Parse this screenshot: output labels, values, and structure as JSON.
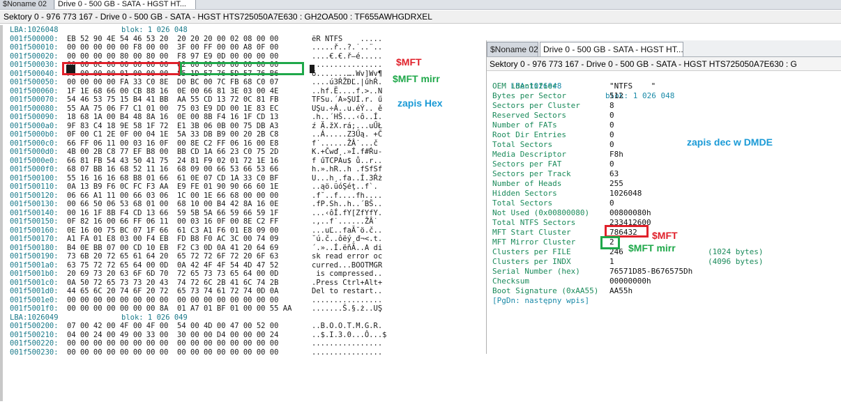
{
  "tabs": [
    {
      "label": "$Noname 02"
    },
    {
      "label": "Drive 0 - 500 GB - SATA - HGST HT..."
    }
  ],
  "status_text": "Sektory 0 - 976 773 167 - Drive 0 - 500 GB - SATA - HGST HTS725050A7E630 : GH2OA500 : TF655AWHGDRXEL",
  "hex_view": {
    "lba1": {
      "lba": "LBA:1026048",
      "blok": "blok: 1 026 048"
    },
    "rows1": [
      {
        "addr": "001f500000:",
        "hex": "EB 52 90 4E 54 46 53 20  20 20 20 00 02 08 00 00",
        "ascii": "ëR NTFS    ....."
      },
      {
        "addr": "001f500010:",
        "hex": "00 00 00 00 00 F8 00 00  3F 00 FF 00 00 A8 0F 00",
        "ascii": ".....ř..?.˙..¨.."
      },
      {
        "addr": "001f500020:",
        "hex": "00 00 00 00 80 00 80 00  F8 97 E9 0D 00 00 00 00",
        "ascii": "....€.€.ř—é....."
      },
      {
        "addr": "001f500030:",
        "hex": "00 00 0C 00 00 00 00 00  02 00 00 00 00 00 00 00",
        "ascii": "................"
      },
      {
        "addr": "001f500040:",
        "hex": "F6 00 00 00 01 00 00 00  85 1D 57 76 5D 57 76 B6",
        "ascii": "ö.......….Wv]Wv¶"
      },
      {
        "addr": "001f500050:",
        "hex": "00 00 00 00 FA 33 C0 8E  D0 BC 00 7C FB 68 C0 07",
        "ascii": "....ú3ŔŽĐĽ.|űhŔ."
      },
      {
        "addr": "001f500060:",
        "hex": "1F 1E 68 66 00 CB 88 16  0E 00 66 81 3E 03 00 4E",
        "ascii": "..hf.Ë....f.>..N"
      },
      {
        "addr": "001f500070:",
        "hex": "54 46 53 75 15 B4 41 BB  AA 55 CD 13 72 0C 81 FB",
        "ascii": "TFSu.´A»ŞUÍ.r. ű"
      },
      {
        "addr": "001f500080:",
        "hex": "55 AA 75 06 F7 C1 01 00  75 03 E9 DD 00 1E 83 EC",
        "ascii": "UŞu.÷Á..u.éÝ.. ě"
      },
      {
        "addr": "001f500090:",
        "hex": "18 68 1A 00 B4 48 8A 16  0E 00 8B F4 16 1F CD 13",
        "ascii": ".h..´HŠ...‹ô..Í."
      },
      {
        "addr": "001f5000a0:",
        "hex": "9F 83 C4 18 9E 58 1F 72  E1 3B 06 0B 00 75 DB A3",
        "ascii": "ź Ä.žX.rá;...uŰŁ"
      },
      {
        "addr": "001f5000b0:",
        "hex": "0F 00 C1 2E 0F 00 04 1E  5A 33 DB B9 00 20 2B C8",
        "ascii": "..Á.....Z3Űą. +Č"
      },
      {
        "addr": "001f5000c0:",
        "hex": "66 FF 06 11 00 03 16 0F  00 8E C2 FF 06 16 00 E8",
        "ascii": "f˙......ŽÂ˙...č"
      },
      {
        "addr": "001f5000d0:",
        "hex": "4B 00 2B C8 77 EF B8 00  BB CD 1A 66 23 C0 75 2D",
        "ascii": "K.+Čwď¸.»Í.f#Ŕu-"
      },
      {
        "addr": "001f5000e0:",
        "hex": "66 81 FB 54 43 50 41 75  24 81 F9 02 01 72 1E 16",
        "ascii": "f űTCPAu$ ů..r.."
      },
      {
        "addr": "001f5000f0:",
        "hex": "68 07 BB 16 68 52 11 16  68 09 00 66 53 66 53 66",
        "ascii": "h.».hR..h .fSfSf"
      },
      {
        "addr": "001f500100:",
        "hex": "55 16 16 16 68 B8 01 66  61 0E 07 CD 1A 33 C0 BF",
        "ascii": "U...h¸.fa..Í.3Ŕż"
      },
      {
        "addr": "001f500110:",
        "hex": "0A 13 B9 F6 0C FC F3 AA  E9 FE 01 90 90 66 60 1E",
        "ascii": "..ąö.üóŞéţ..f`."
      },
      {
        "addr": "001f500120:",
        "hex": "06 66 A1 11 00 66 03 06  1C 00 1E 66 68 00 00 00",
        "ascii": ".f˘..f....fh...."
      },
      {
        "addr": "001f500130:",
        "hex": "00 66 50 06 53 68 01 00  68 10 00 B4 42 8A 16 0E",
        "ascii": ".fP.Sh..h..´BŠ.."
      },
      {
        "addr": "001f500140:",
        "hex": "00 16 1F 8B F4 CD 13 66  59 5B 5A 66 59 66 59 1F",
        "ascii": "...‹ôÍ.fY[ZfYfY."
      },
      {
        "addr": "001f500150:",
        "hex": "0F 82 16 00 66 FF 06 11  00 03 16 0F 00 8E C2 FF",
        "ascii": ".‚..f˙......ŽÂ˙"
      },
      {
        "addr": "001f500160:",
        "hex": "0E 16 00 75 BC 07 1F 66  61 C3 A1 F6 01 E8 09 00",
        "ascii": "...uĽ..faĂ˘ö.č.."
      },
      {
        "addr": "001f500170:",
        "hex": "A1 FA 01 E8 03 00 F4 EB  FD B8 F0 AC 3C 00 74 09",
        "ascii": "˘ú.č..ôëý¸đ¬<.t."
      },
      {
        "addr": "001f500180:",
        "hex": "B4 0E BB 07 00 CD 10 EB  F2 C3 0D 0A 41 20 64 69",
        "ascii": "´.»..Í.ëňĂ..A di"
      },
      {
        "addr": "001f500190:",
        "hex": "73 6B 20 72 65 61 64 20  65 72 72 6F 72 20 6F 63",
        "ascii": "sk read error oc"
      },
      {
        "addr": "001f5001a0:",
        "hex": "63 75 72 72 65 64 00 0D  0A 42 4F 4F 54 4D 47 52",
        "ascii": "curred...BOOTMGR"
      },
      {
        "addr": "001f5001b0:",
        "hex": "20 69 73 20 63 6F 6D 70  72 65 73 73 65 64 00 0D",
        "ascii": " is compressed.."
      },
      {
        "addr": "001f5001c0:",
        "hex": "0A 50 72 65 73 73 20 43  74 72 6C 2B 41 6C 74 2B",
        "ascii": ".Press Ctrl+Alt+"
      },
      {
        "addr": "001f5001d0:",
        "hex": "44 65 6C 20 74 6F 20 72  65 73 74 61 72 74 0D 0A",
        "ascii": "Del to restart.."
      },
      {
        "addr": "001f5001e0:",
        "hex": "00 00 00 00 00 00 00 00  00 00 00 00 00 00 00 00",
        "ascii": "................"
      },
      {
        "addr": "001f5001f0:",
        "hex": "00 00 00 00 00 00 00 8A  01 A7 01 BF 01 00 00 55 AA",
        "ascii": ".......Š.§.ż..UŞ"
      }
    ],
    "lba2": {
      "lba": "LBA:1026049",
      "blok": "blok: 1 026 049"
    },
    "rows2": [
      {
        "addr": "001f500200:",
        "hex": "07 00 42 00 4F 00 4F 00  54 00 4D 00 47 00 52 00",
        "ascii": "..B.O.O.T.M.G.R."
      },
      {
        "addr": "001f500210:",
        "hex": "04 00 24 00 49 00 33 00  30 00 00 D4 00 00 00 24",
        "ascii": "..$.I.3.0...Ô...$"
      },
      {
        "addr": "001f500220:",
        "hex": "00 00 00 00 00 00 00 00  00 00 00 00 00 00 00 00",
        "ascii": "................"
      },
      {
        "addr": "001f500230:",
        "hex": "00 00 00 00 00 00 00 00  00 00 00 00 00 00 00 00",
        "ascii": "................"
      }
    ]
  },
  "annotations": {
    "mft_hex": "$MFT",
    "mftmirr_hex": "$MFT mirr",
    "zapis_hex": "zapis Hex",
    "zapis_dec": "zapis dec w DMDE",
    "mft_dec": "$MFT",
    "mftmirr_dec": "$MFT mirr"
  },
  "panel": {
    "tabs": [
      {
        "label": "$Noname 02"
      },
      {
        "label": "Drive 0 - 500 GB - SATA - HGST HT..."
      }
    ],
    "status_text": "Sektory 0 - 976 773 167 - Drive 0 - 500 GB - SATA - HGST HTS725050A7E630 : G",
    "lba": "LBA:1026048",
    "blok": "blok: 1 026 048",
    "fields": [
      {
        "label": "OEM identifier",
        "value": "\"NTFS    \"",
        "extra": ""
      },
      {
        "label": "Bytes per Sector",
        "value": "512",
        "extra": ""
      },
      {
        "label": "Sectors per Cluster",
        "value": "8",
        "extra": ""
      },
      {
        "label": "Reserved Sectors",
        "value": "0",
        "extra": ""
      },
      {
        "label": "Number of FATs",
        "value": "0",
        "extra": ""
      },
      {
        "label": "Root Dir Entries",
        "value": "0",
        "extra": ""
      },
      {
        "label": "Total Sectors",
        "value": "0",
        "extra": ""
      },
      {
        "label": "Media Descriptor",
        "value": "F8h",
        "extra": ""
      },
      {
        "label": "Sectors per FAT",
        "value": "0",
        "extra": ""
      },
      {
        "label": "Sectors per Track",
        "value": "63",
        "extra": ""
      },
      {
        "label": "Number of Heads",
        "value": "255",
        "extra": ""
      },
      {
        "label": "Hidden Sectors",
        "value": "1026048",
        "extra": ""
      },
      {
        "label": "Total Sectors",
        "value": "0",
        "extra": ""
      },
      {
        "label": "Not Used (0x00800080)",
        "value": "00800080h",
        "extra": ""
      },
      {
        "label": "Total NTFS Sectors",
        "value": "233412600",
        "extra": ""
      },
      {
        "label": "MFT Start Cluster",
        "value": "786432",
        "extra": ""
      },
      {
        "label": "MFT Mirror Cluster",
        "value": "2",
        "extra": ""
      },
      {
        "label": "Clusters per FILE",
        "value": "246",
        "extra": "(1024 bytes)"
      },
      {
        "label": "Clusters per INDX",
        "value": "1",
        "extra": "(4096 bytes)"
      },
      {
        "label": "Serial Number (hex)",
        "value": "76571D85-B676575Dh",
        "extra": ""
      },
      {
        "label": "Checksum",
        "value": "00000000h",
        "extra": ""
      },
      {
        "label": "Boot Signature (0xAA55)",
        "value": "AA55h",
        "extra": ""
      }
    ],
    "footer": "[PgDn: następny wpis]"
  },
  "colors": {
    "highlight_red": "#e0202a",
    "highlight_green": "#1fa84a",
    "annotation_blue": "#1a9ad6"
  }
}
